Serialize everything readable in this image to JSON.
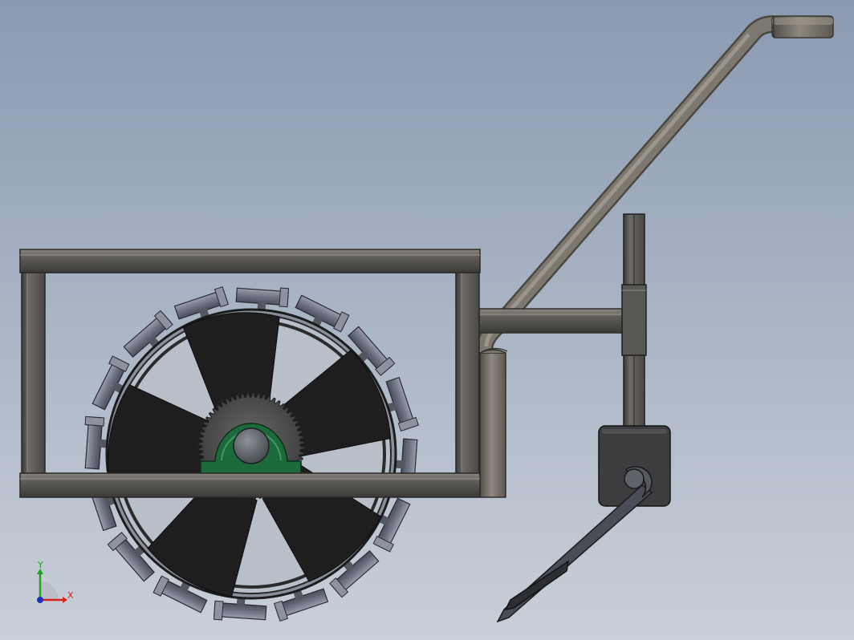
{
  "viewport": {
    "background_top": "#8a9ab1",
    "background_bottom": "#c9cfd8"
  },
  "colors": {
    "frame": "#5b5955",
    "frame_light": "#7b7873",
    "frame_dark": "#3d3b38",
    "tube": "#6e6a63",
    "tube_light": "#8c877e",
    "wheel_disc": "#1e1e1e",
    "wheel_rim": "#2b2b2b",
    "cleat": "#6f7282",
    "cleat_light": "#8e91a0",
    "gear": "#4a4a4a",
    "bearing_green": "#1d6b3a",
    "hub": "#555a5f",
    "bracket": "#3a3a3a",
    "post": "#3f4247",
    "axis_x": "#d42020",
    "axis_y": "#1ba51b",
    "axis_z": "#1c2fb8"
  },
  "triad": {
    "x_label": "X",
    "y_label": "Y"
  }
}
